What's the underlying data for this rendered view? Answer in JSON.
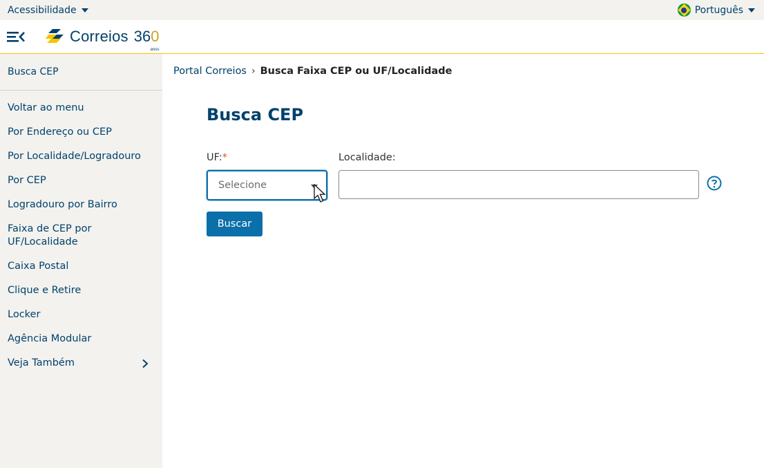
{
  "topbar": {
    "accessibility_label": "Acessibilidade",
    "language_label": "Português"
  },
  "header": {
    "logo_text": "Correios",
    "logo_number": "36",
    "logo_number_o": "0",
    "logo_anos": "anos",
    "brand_colors": {
      "blue": "#00416b",
      "yellow": "#f5c400"
    }
  },
  "sidebar": {
    "title": "Busca CEP",
    "items": [
      {
        "label": "Voltar ao menu"
      },
      {
        "label": "Por Endereço ou CEP"
      },
      {
        "label": "Por Localidade/Logradouro"
      },
      {
        "label": "Por CEP"
      },
      {
        "label": "Logradouro por Bairro"
      },
      {
        "label": "Faixa de CEP por UF/Localidade"
      },
      {
        "label": "Caixa Postal"
      },
      {
        "label": "Clique e Retire"
      },
      {
        "label": "Locker"
      },
      {
        "label": "Agência Modular"
      },
      {
        "label": "Veja Também"
      }
    ]
  },
  "breadcrumb": {
    "root": "Portal Correios",
    "separator": "›",
    "current": "Busca Faixa CEP ou UF/Localidade"
  },
  "main": {
    "title": "Busca CEP",
    "uf_label": "UF:",
    "uf_required_mark": "*",
    "uf_selected": "Selecione",
    "localidade_label": "Localidade:",
    "localidade_value": "",
    "submit_label": "Buscar"
  },
  "icons": {
    "menu": "menu-collapse-icon",
    "help": "help-circle-icon",
    "chevron": "chevron-right-icon",
    "flag": "brazil-flag-icon"
  }
}
